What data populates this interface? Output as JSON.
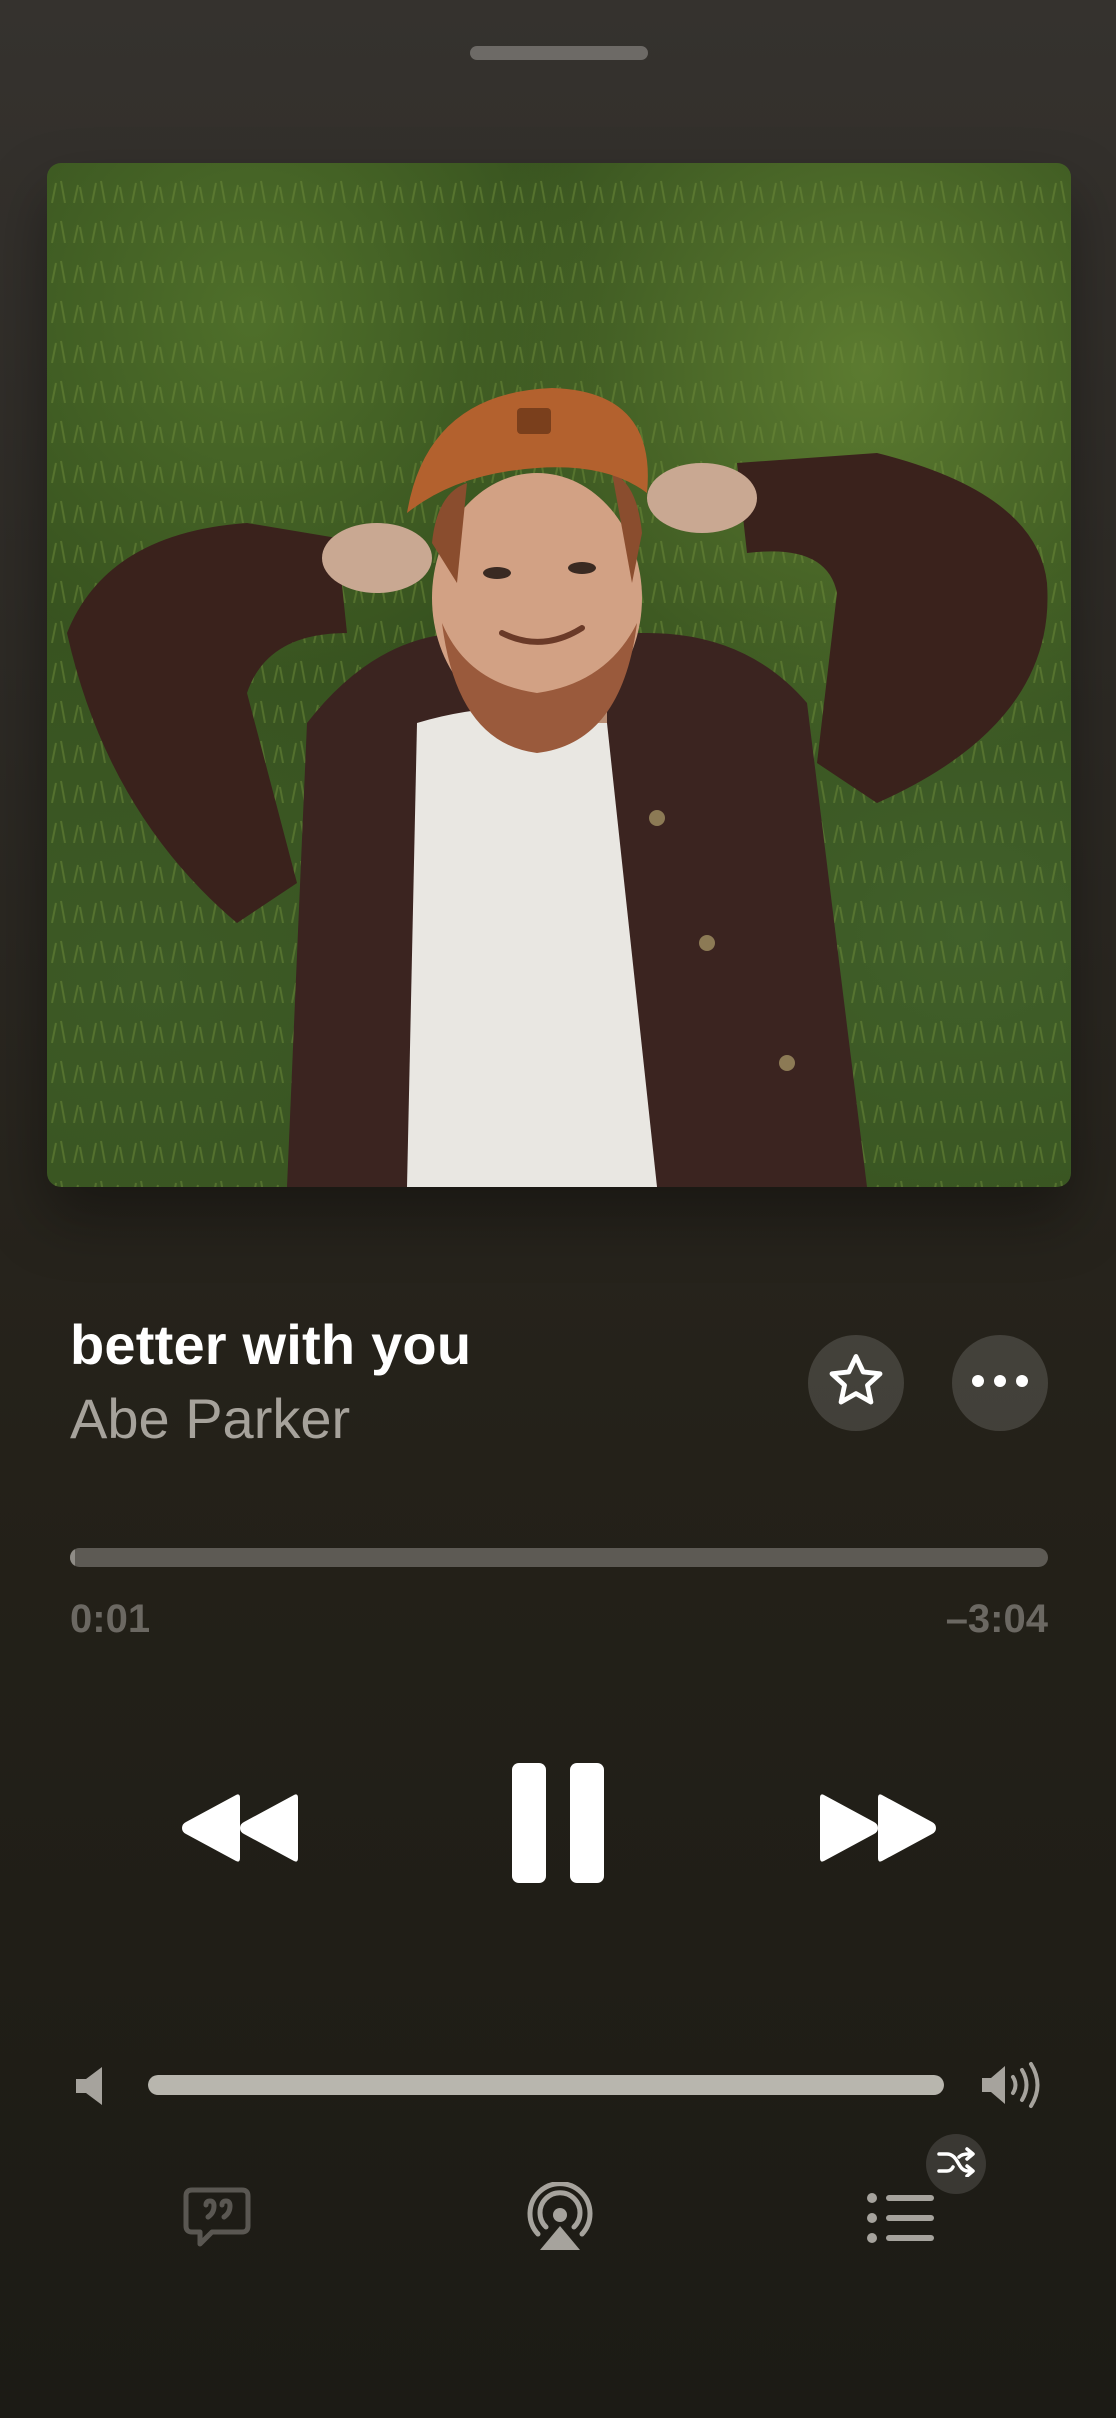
{
  "player": {
    "song_title": "better with you",
    "artist": "Abe Parker",
    "time_elapsed": "0:01",
    "time_remaining": "–3:04",
    "progress": 0.005,
    "volume": 1.0,
    "shuffle_on": true
  },
  "icons": {
    "favorite": "star-icon",
    "more": "more-icon",
    "rewind": "rewind-icon",
    "pause": "pause-icon",
    "forward": "fast-forward-icon",
    "volume_low": "speaker-low-icon",
    "volume_high": "speaker-high-icon",
    "lyrics": "lyrics-icon",
    "airplay": "airplay-icon",
    "queue": "queue-list-icon",
    "shuffle": "shuffle-icon"
  },
  "colors": {
    "background_top": "#35322e",
    "background_bottom": "#1c1b15",
    "title": "#ffffff",
    "artist": "#a6a29b",
    "muted": "#6b6862"
  }
}
